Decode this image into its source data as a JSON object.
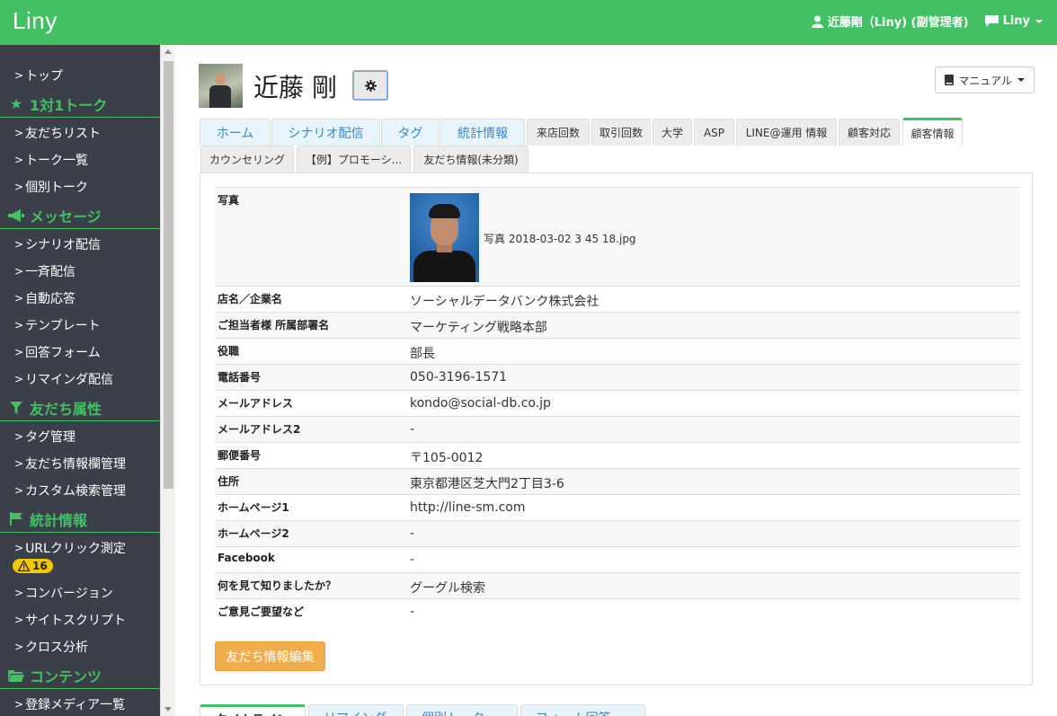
{
  "navbar": {
    "brand": "Liny",
    "user_label": "近藤剛（Liny) (副管理者)",
    "account_label": "Liny"
  },
  "sidebar": {
    "top": "トップ",
    "talk_head": "1対1トーク",
    "talk_items": [
      "友だちリスト",
      "トーク一覧",
      "個別トーク"
    ],
    "message_head": "メッセージ",
    "message_items": [
      "シナリオ配信",
      "一斉配信",
      "自動応答",
      "テンプレート",
      "回答フォーム",
      "リマインダ配信"
    ],
    "attr_head": "友だち属性",
    "attr_items": [
      "タグ管理",
      "友だち情報欄管理",
      "カスタム検索管理"
    ],
    "stats_head": "統計情報",
    "stats_items": [
      "URLクリック測定",
      "コンバージョン",
      "サイトスクリプト",
      "クロス分析"
    ],
    "warning_count": "16",
    "content_head": "コンテンツ",
    "content_items": [
      "登録メディア一覧"
    ]
  },
  "profile": {
    "name": "近藤 剛",
    "manual_label": "マニュアル"
  },
  "tabs_row1": [
    "ホーム",
    "シナリオ配信",
    "タグ",
    "統計情報",
    "来店回数",
    "取引回数",
    "大学",
    "ASP",
    "LINE@運用 情報",
    "顧客対応",
    "顧客情報"
  ],
  "tabs_row2": [
    "カウンセリング",
    "【例】プロモーシ...",
    "友だち情報(未分類)"
  ],
  "info": {
    "photo_label": "写真",
    "photo_caption": "写真 2018-03-02 3 45 18.jpg",
    "rows": [
      {
        "key": "店名／企業名",
        "value": "ソーシャルデータバンク株式会社"
      },
      {
        "key": "ご担当者様 所属部署名",
        "value": "マーケティング戦略本部"
      },
      {
        "key": "役職",
        "value": "部長"
      },
      {
        "key": "電話番号",
        "value": "050-3196-1571"
      },
      {
        "key": "メールアドレス",
        "value": "kondo@social-db.co.jp"
      },
      {
        "key": "メールアドレス2",
        "value": "-"
      },
      {
        "key": "郵便番号",
        "value": "〒105-0012"
      },
      {
        "key": "住所",
        "value": "東京都港区芝大門2丁目3-6"
      },
      {
        "key": "ホームページ1",
        "value": "http://line-sm.com"
      },
      {
        "key": "ホームページ2",
        "value": "-"
      },
      {
        "key": "Facebook",
        "value": "-"
      },
      {
        "key": "何を見て知りましたか？",
        "value": "グーグル検索"
      },
      {
        "key": "ご意見ご要望など",
        "value": "-"
      }
    ],
    "edit_button": "友だち情報編集"
  },
  "bottom_tabs": [
    "タイムライン",
    "リマインダ",
    "個別トーク",
    "フォーム回答"
  ]
}
